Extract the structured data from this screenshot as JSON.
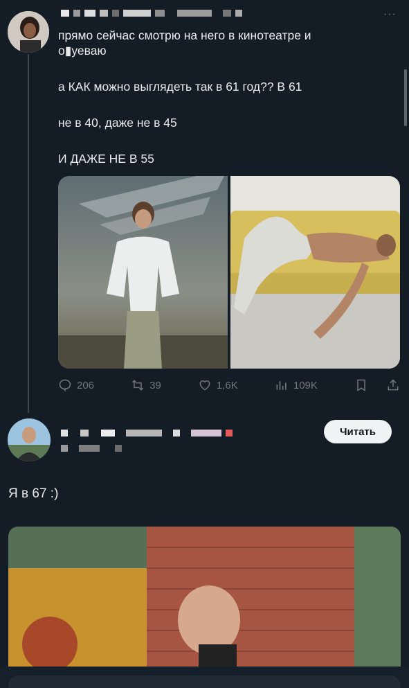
{
  "tweet": {
    "text_lines": [
      "прямо сейчас смотрю на него в кинотеатре и",
      "о▮уеваю",
      "а КАК можно выглядеть так в 61 год?? В 61",
      "не в 40, даже не в 45",
      "И ДАЖЕ НЕ В 55"
    ],
    "more_icon": "more-dots-icon",
    "actions": {
      "replies": "206",
      "reposts": "39",
      "likes": "1,6K",
      "views": "109K"
    }
  },
  "reply": {
    "follow_label": "Читать",
    "text": "Я в 67 :)"
  },
  "colors": {
    "background": "#141d26",
    "text": "#e7e9ea",
    "muted": "#71767b",
    "button_bg": "#eff3f4"
  }
}
